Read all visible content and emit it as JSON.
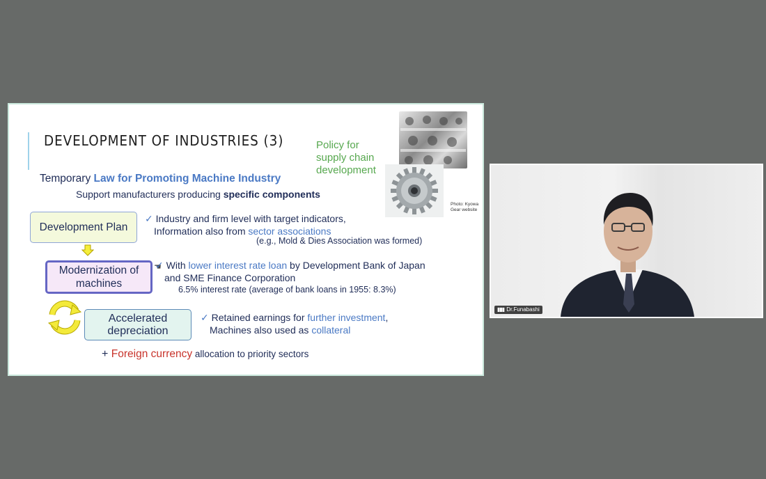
{
  "slide": {
    "title": "DEVELOPMENT OF INDUSTRIES (3)",
    "policy_note": [
      "Policy for",
      "supply chain",
      "development"
    ],
    "photo_credit": [
      "Photo: Kyowa",
      "Gear website"
    ],
    "law_prefix": "Temporary ",
    "law_name": "Law for Promoting Machine Industry",
    "support_prefix": "Support manufacturers producing ",
    "support_bold": "specific components",
    "boxes": {
      "dev_plan": "Development Plan",
      "modernization": [
        "Modernization of",
        "machines"
      ],
      "accelerated": [
        "Accelerated",
        "depreciation"
      ]
    },
    "bullet1": {
      "check": "✓",
      "line1": "Industry and firm level with target indicators,",
      "line2_prefix": "Information also from ",
      "line2_highlight": "sector associations",
      "example": "(e.g., Mold & Dies Association was formed)"
    },
    "bullet2": {
      "check": "✓",
      "prefix": "With ",
      "highlight": "lower interest rate loan",
      "suffix": " by Development Bank of Japan",
      "line2": "and SME Finance Corporation",
      "rate_line": "6.5% interest rate (average of bank loans in 1955: 8.3%)"
    },
    "bullet3": {
      "check": "✓",
      "prefix": "Retained earnings for ",
      "highlight": "further investment",
      "suffix": ",",
      "line2_prefix": "Machines also used as ",
      "line2_highlight": "collateral"
    },
    "foreign": {
      "plus": "+ ",
      "highlight": "Foreign currency",
      "suffix": " allocation to priority sectors"
    }
  },
  "video": {
    "participant_name": "Dr.Funabashi"
  },
  "colors": {
    "background": "#676a68",
    "accent_blue": "#4a79c4",
    "policy_green": "#57a84f",
    "foreign_red": "#c8332b"
  }
}
